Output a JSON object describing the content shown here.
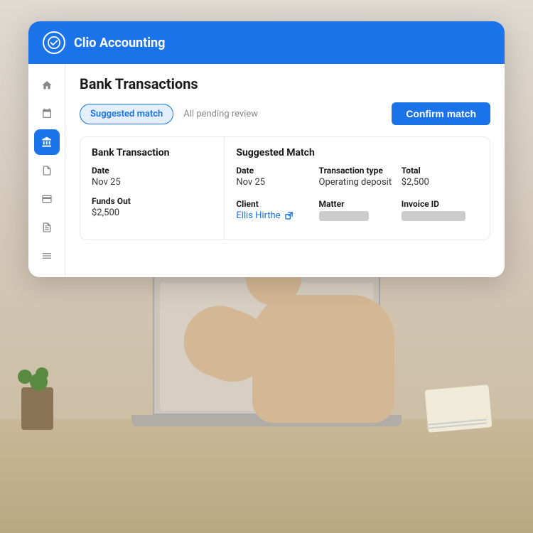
{
  "app": {
    "name": "Clio Accounting",
    "icon": "check-circle-icon"
  },
  "sidebar": {
    "items": [
      {
        "icon": "🏠",
        "label": "Home",
        "active": false
      },
      {
        "icon": "📅",
        "label": "Calendar",
        "active": false
      },
      {
        "icon": "🏦",
        "label": "Bank",
        "active": true
      },
      {
        "icon": "📋",
        "label": "Documents",
        "active": false
      },
      {
        "icon": "💵",
        "label": "Billing",
        "active": false
      },
      {
        "icon": "📄",
        "label": "Reports",
        "active": false
      },
      {
        "icon": "☰",
        "label": "More",
        "active": false
      }
    ]
  },
  "page": {
    "title": "Bank Transactions"
  },
  "tabs": [
    {
      "label": "Suggested match",
      "active": true
    },
    {
      "label": "All pending review",
      "active": false
    }
  ],
  "confirm_button": "Confirm match",
  "bank_transaction": {
    "header": "Bank Transaction",
    "date_label": "Date",
    "date_value": "Nov 25",
    "funds_out_label": "Funds Out",
    "funds_out_value": "$2,500"
  },
  "suggested_match": {
    "header": "Suggested Match",
    "date_label": "Date",
    "date_value": "Nov 25",
    "transaction_type_label": "Transaction type",
    "transaction_type_value": "Operating deposit",
    "total_label": "Total",
    "total_value": "$2,500",
    "client_label": "Client",
    "client_value": "Ellis Hirthe",
    "matter_label": "Matter",
    "invoice_id_label": "Invoice ID"
  }
}
